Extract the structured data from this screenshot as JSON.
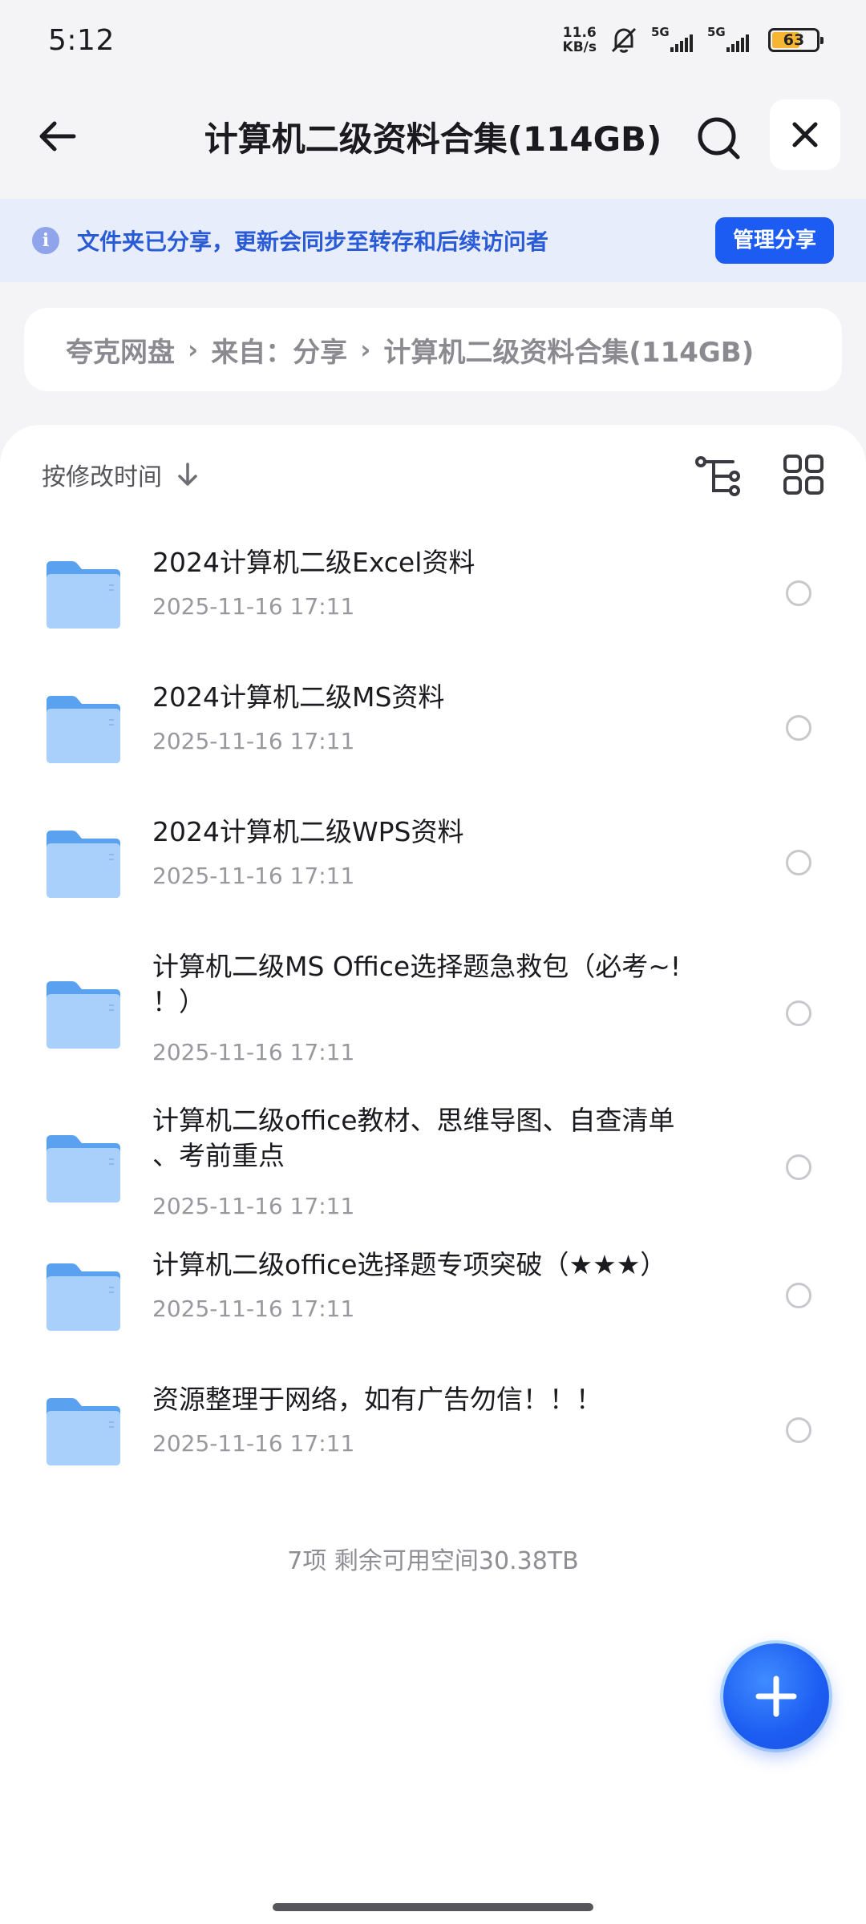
{
  "status_bar": {
    "time": "5:12",
    "net_speed_value": "11.6",
    "net_speed_unit": "KB/s",
    "sim1_label": "5G",
    "sim2_label": "5G",
    "battery_level": "63"
  },
  "header": {
    "title": "计算机二级资料合集(114GB)",
    "icons": [
      "back-arrow-icon",
      "search-icon",
      "close-icon"
    ]
  },
  "share_banner": {
    "message": "文件夹已分享，更新会同步至转存和后续访问者",
    "manage_label": "管理分享"
  },
  "breadcrumb": {
    "items": [
      "夸克网盘",
      "来自：分享",
      "计算机二级资料合集(114GB)"
    ]
  },
  "sort": {
    "label": "按修改时间"
  },
  "files": [
    {
      "name": "2024计算机二级Excel资料",
      "date": "2025-11-16 17:11"
    },
    {
      "name": "2024计算机二级MS资料",
      "date": "2025-11-16 17:11"
    },
    {
      "name": "2024计算机二级WPS资料",
      "date": "2025-11-16 17:11"
    },
    {
      "name": "计算机二级MS Office选择题急救包（必考~!\n！）",
      "date": "2025-11-16 17:11"
    },
    {
      "name": "计算机二级office教材、思维导图、自查清单\n、考前重点",
      "date": "2025-11-16 17:11"
    },
    {
      "name": "计算机二级office选择题专项突破（★★★）",
      "date": "2025-11-16 17:11"
    },
    {
      "name": "资源整理于网络，如有广告勿信！！！",
      "date": "2025-11-16 17:11"
    }
  ],
  "footer": {
    "summary": "7项 剩余可用空间30.38TB"
  },
  "colors": {
    "accent": "#1c5cf2",
    "banner_bg": "#e8edfb",
    "folder_light": "#a9d0fb",
    "folder_dark": "#5aa2ef"
  }
}
